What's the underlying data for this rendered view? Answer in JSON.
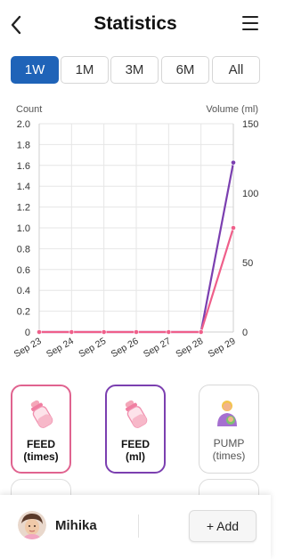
{
  "header": {
    "title": "Statistics",
    "back_icon": "chevron-left-icon",
    "menu_icon": "hamburger-menu-icon"
  },
  "range_tabs": [
    {
      "label": "1W",
      "active": true
    },
    {
      "label": "1M",
      "active": false
    },
    {
      "label": "3M",
      "active": false
    },
    {
      "label": "6M",
      "active": false
    },
    {
      "label": "All",
      "active": false
    }
  ],
  "chart_data": {
    "type": "line",
    "ylabel_left": "Count",
    "ylabel_right": "Volume (ml)",
    "categories": [
      "Sep 23",
      "Sep 24",
      "Sep 25",
      "Sep 26",
      "Sep 27",
      "Sep 28",
      "Sep 29"
    ],
    "ylim_left": [
      0,
      2.0
    ],
    "ylim_right": [
      0,
      150
    ],
    "left_ticks": [
      "0",
      "0.2",
      "0.4",
      "0.6",
      "0.8",
      "1.0",
      "1.2",
      "1.4",
      "1.6",
      "1.8",
      "2.0"
    ],
    "right_ticks": [
      "0",
      "50",
      "100",
      "150"
    ],
    "grid": true,
    "series": [
      {
        "axis": "left",
        "color": "#ef5f8a",
        "values": [
          0,
          0,
          0,
          0,
          0,
          0,
          1.0
        ]
      },
      {
        "axis": "right",
        "color": "#7b3fb0",
        "values": [
          0,
          0,
          0,
          0,
          0,
          0,
          122
        ]
      }
    ]
  },
  "cards": [
    {
      "label": "FEED\n(times)",
      "icon": "baby-bottle-icon",
      "accent": "#e0638f"
    },
    {
      "label": "FEED\n(ml)",
      "icon": "baby-bottle-icon",
      "accent": "#7b3fb0"
    },
    {
      "label": "PUMP\n(times)",
      "icon": "breast-pump-person-icon",
      "accent": "#d8d8d8"
    }
  ],
  "bottom_bar": {
    "child_name": "Mihika",
    "add_label": "+ Add",
    "avatar_icon": "child-avatar-icon"
  }
}
